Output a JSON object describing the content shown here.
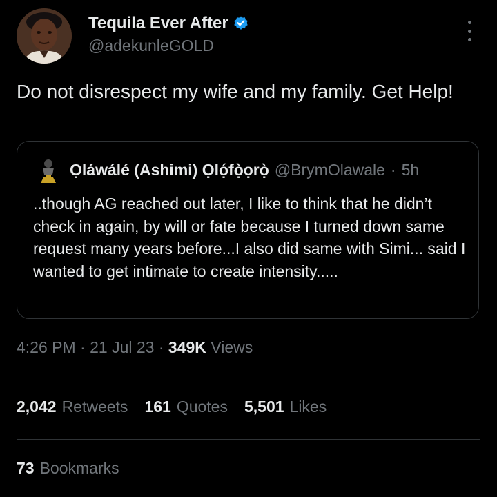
{
  "author": {
    "display_name": "Tequila Ever After",
    "handle": "@adekunleGOLD",
    "verified": true
  },
  "tweet": {
    "text": "Do not disrespect my wife and my family. Get Help!"
  },
  "quoted_tweet": {
    "display_name": "Ọláwálé (Ashimi) Ọlọ́fọ̀ọrọ̀",
    "handle": "@BrymOlawale",
    "dot": "·",
    "time": "5h",
    "text": "..though AG reached out later, I like to think that he didn’t check in again, by will or fate because I turned down same request many years before...I also did same with Simi... said I wanted to get intimate to create intensity....."
  },
  "meta": {
    "time": "4:26 PM",
    "sep1": "·",
    "date": "21 Jul 23",
    "sep2": "·",
    "views_count": "349K",
    "views_label": "Views"
  },
  "stats": {
    "retweets": {
      "count": "2,042",
      "label": "Retweets"
    },
    "quotes": {
      "count": "161",
      "label": "Quotes"
    },
    "likes": {
      "count": "5,501",
      "label": "Likes"
    },
    "bookmarks": {
      "count": "73",
      "label": "Bookmarks"
    }
  },
  "colors": {
    "background": "#000000",
    "text_primary": "#e7e9ea",
    "text_secondary": "#71767b",
    "verified_blue": "#1d9bf0",
    "divider": "#2f3336"
  },
  "icons": {
    "verified": "verified-badge-icon",
    "more": "more-vertical-icon"
  }
}
